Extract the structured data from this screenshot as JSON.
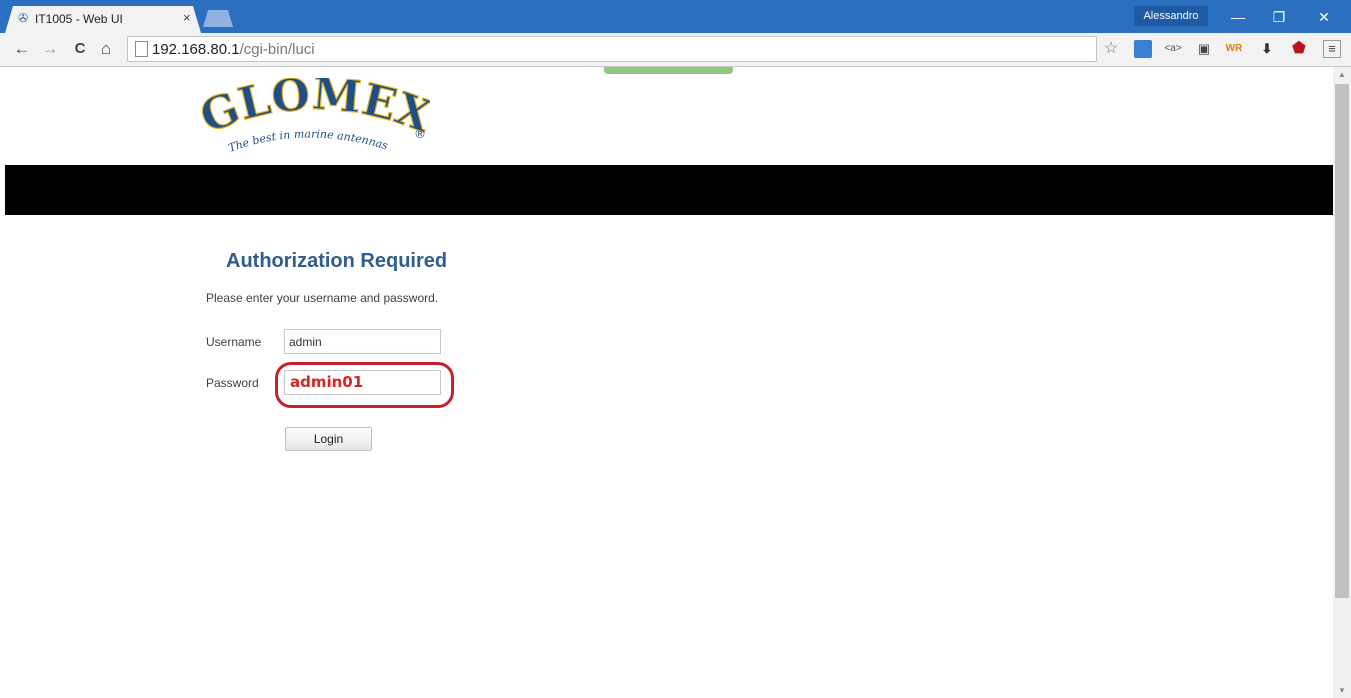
{
  "browser": {
    "tab_title": "IT1005 - Web UI",
    "tab_close": "×",
    "user_name": "Alessandro",
    "window_controls": {
      "minimize": "—",
      "restore": "❐",
      "close": "✕"
    },
    "nav": {
      "back": "←",
      "forward": "→",
      "reload": "C",
      "home": "⌂"
    },
    "url_host": "192.168.80.1",
    "url_path": "/cgi-bin/luci",
    "extensions": [
      "star-icon",
      "screen-icon",
      "tag-icon",
      "puzzle-icon",
      "wiki-icon",
      "download-icon",
      "ublock-icon",
      "menu-icon"
    ]
  },
  "page": {
    "logo_text": "GLOMEX",
    "logo_tagline": "The best in marine antennas",
    "logo_mark": "®",
    "auth_title": "Authorization Required",
    "auth_description": "Please enter your username and password.",
    "username_label": "Username",
    "username_value": "admin",
    "password_label": "Password",
    "password_value": "admin01",
    "login_label": "Login"
  },
  "colors": {
    "title_bar": "#2b6fc1",
    "heading": "#2f5d8e",
    "highlight": "#c8202a"
  }
}
